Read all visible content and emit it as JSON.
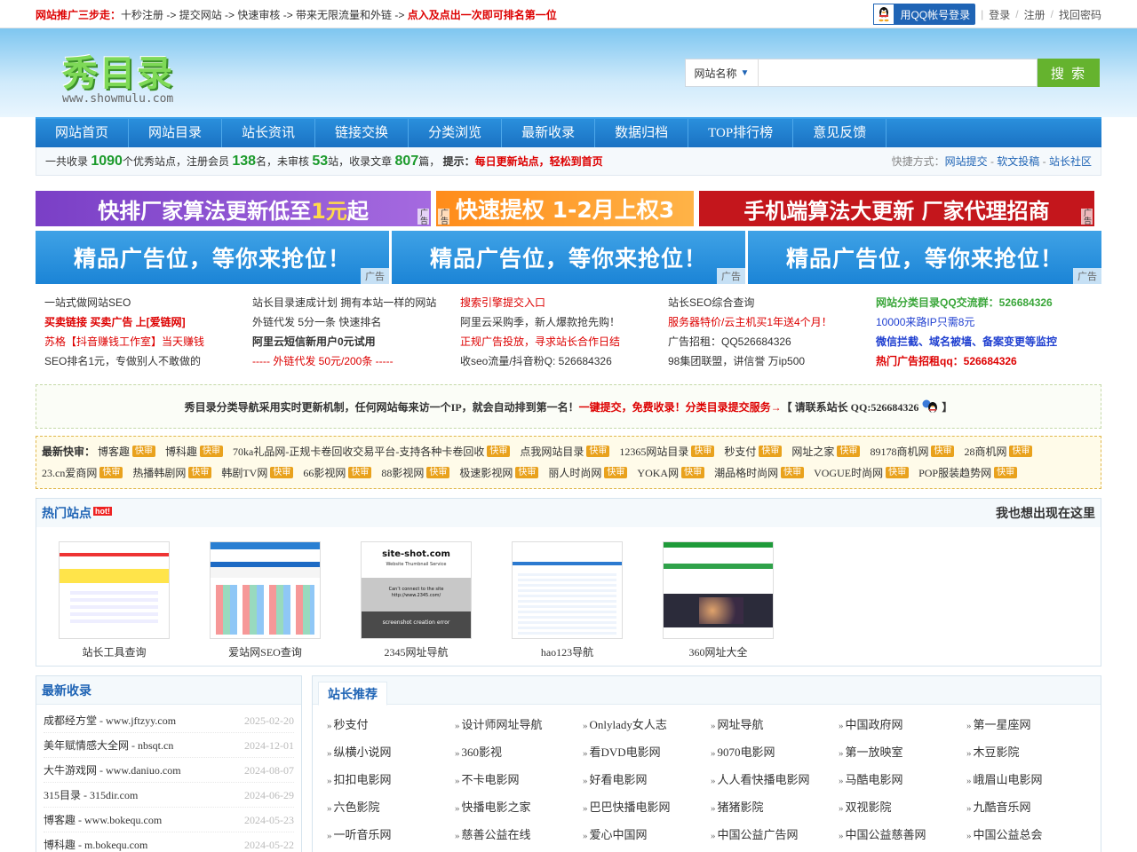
{
  "topbar": {
    "promo_title": "网站推广三步走：",
    "promo_steps": "十秒注册 -> 提交网站 -> 快速审核 -> 带来无限流量和外链 -> ",
    "promo_end": "点入及点出一次即可排名第一位",
    "qq_login": "用QQ帐号登录",
    "login": "登录",
    "register": "注册",
    "find_password": "找回密码"
  },
  "header": {
    "logo": "秀目录",
    "logo_url": "www.showmulu.com",
    "search_select": "网站名称",
    "search_placeholder": "",
    "search_button": "搜 索"
  },
  "nav": [
    "网站首页",
    "网站目录",
    "站长资讯",
    "链接交换",
    "分类浏览",
    "最新收录",
    "数据归档",
    "TOP排行榜",
    "意见反馈"
  ],
  "stats": {
    "t1": "一共收录",
    "sites": "1090",
    "t2": "个优秀站点，注册会员",
    "members": "138",
    "t3": "名，未审核",
    "pending": "53",
    "t4": "站，收录文章",
    "articles": "807",
    "t5": "篇，",
    "tip_label": "提示：",
    "tip_text": "每日更新站点，轻松到首页",
    "quick_label": "快捷方式：",
    "quick": [
      "网站提交",
      "软文投稿",
      "站长社区"
    ]
  },
  "ads_top": {
    "a1_pre": "快排厂家算法更新低至",
    "a1_hl": "1元",
    "a1_post": "起",
    "a2": "快速提权 1-2月上权3",
    "a3": "手机端算法大更新  厂家代理招商",
    "tag": "广告"
  },
  "ads_slots": [
    {
      "text": "精品广告位，等你来抢位！",
      "tag": "广告"
    },
    {
      "text": "精品广告位，等你来抢位！",
      "tag": "广告"
    },
    {
      "text": "精品广告位，等你来抢位！",
      "tag": "广告"
    }
  ],
  "textlinks": [
    "一站式做网站SEO",
    "站长目录速成计划 拥有本站一样的网站",
    "搜索引擎提交入口",
    "站长SEO综合查询",
    "网站分类目录QQ交流群：526684326",
    "买卖链接 买卖广告 上[爱链网]",
    "外链代发 5分一条 快速排名",
    "阿里云采购季，新人爆款抢先购！",
    "服务器特价/云主机买1年送4个月！",
    "10000来路IP只需8元",
    "苏格【抖音赚钱工作室】当天赚钱",
    "阿里云短信新用户0元试用",
    "正规广告投放，寻求站长合作日结",
    "广告招租：QQ526684326",
    "微信拦截、域名被墙、备案变更等监控",
    "SEO排名1元，专做别人不敢做的",
    "----- 外链代发 50元/200条 -----",
    "收seo流量/抖音粉Q: 526684326",
    "98集团联盟，讲信誉 万ip500",
    "热门广告招租qq：526684326"
  ],
  "notice": {
    "text1": "秀目录分类导航采用实时更新机制，任何网站每来访一个IP，就会自动排到第一名！",
    "text2": "一键提交，免费收录！分类目录提交服务→",
    "text3": "【 请联系站长 QQ:526684326",
    "text4": "】"
  },
  "fast": {
    "label": "最新快审：",
    "badge": "快审",
    "sites": [
      "博客趣",
      "博科趣",
      "70ka礼品网-正规卡卷回收交易平台-支持各种卡卷回收",
      "点我网站目录",
      "12365网站目录",
      "秒支付",
      "网址之家",
      "89178商机网",
      "28商机网",
      "23.cn爱商网",
      "热播韩剧网",
      "韩剧TV网",
      "66影视网",
      "88影视网",
      "极速影视网",
      "丽人时尚网",
      "YOKA网",
      "潮品格时尚网",
      "VOGUE时尚网",
      "POP服装趋势网"
    ]
  },
  "hot": {
    "title": "热门站点",
    "hot_badge": "hot!",
    "right": "我也想出现在这里",
    "sites": [
      "站长工具查询",
      "爱站网SEO查询",
      "2345网址导航",
      "hao123导航",
      "360网址大全"
    ],
    "shot3": {
      "title": "site-shot.com",
      "sub": "Website Thumbnail Service",
      "msg": "Can’t connect to the site",
      "url": "http://www.2345.com/",
      "err": "screenshot creation error"
    }
  },
  "newest": {
    "title": "最新收录",
    "items": [
      {
        "name": "成都经方堂 - www.jftzyy.com",
        "date": "2025-02-20"
      },
      {
        "name": "美年赋情感大全网 - nbsqt.cn",
        "date": "2024-12-01"
      },
      {
        "name": "大牛游戏网 - www.daniuo.com",
        "date": "2024-08-07"
      },
      {
        "name": "315目录 - 315dir.com",
        "date": "2024-06-29"
      },
      {
        "name": "博客趣 - www.bokequ.com",
        "date": "2024-05-23"
      },
      {
        "name": "博科趣 - m.bokequ.com",
        "date": "2024-05-22"
      }
    ]
  },
  "recommend": {
    "title": "站长推荐",
    "arrow": "»",
    "items": [
      "秒支付",
      "设计师网址导航",
      "Onlylady女人志",
      "网址导航",
      "中国政府网",
      "第一星座网",
      "纵横小说网",
      "360影视",
      "看DVD电影网",
      "9070电影网",
      "第一放映室",
      "木豆影院",
      "扣扣电影网",
      "不卡电影网",
      "好看电影网",
      "人人看快播电影网",
      "马酷电影网",
      "峨眉山电影网",
      "六色影院",
      "快播电影之家",
      "巴巴快播电影网",
      "猪猪影院",
      "双视影院",
      "九酷音乐网",
      "一听音乐网",
      "慈善公益在线",
      "爱心中国网",
      "中国公益广告网",
      "中国公益慈善网",
      "中国公益总会"
    ]
  }
}
